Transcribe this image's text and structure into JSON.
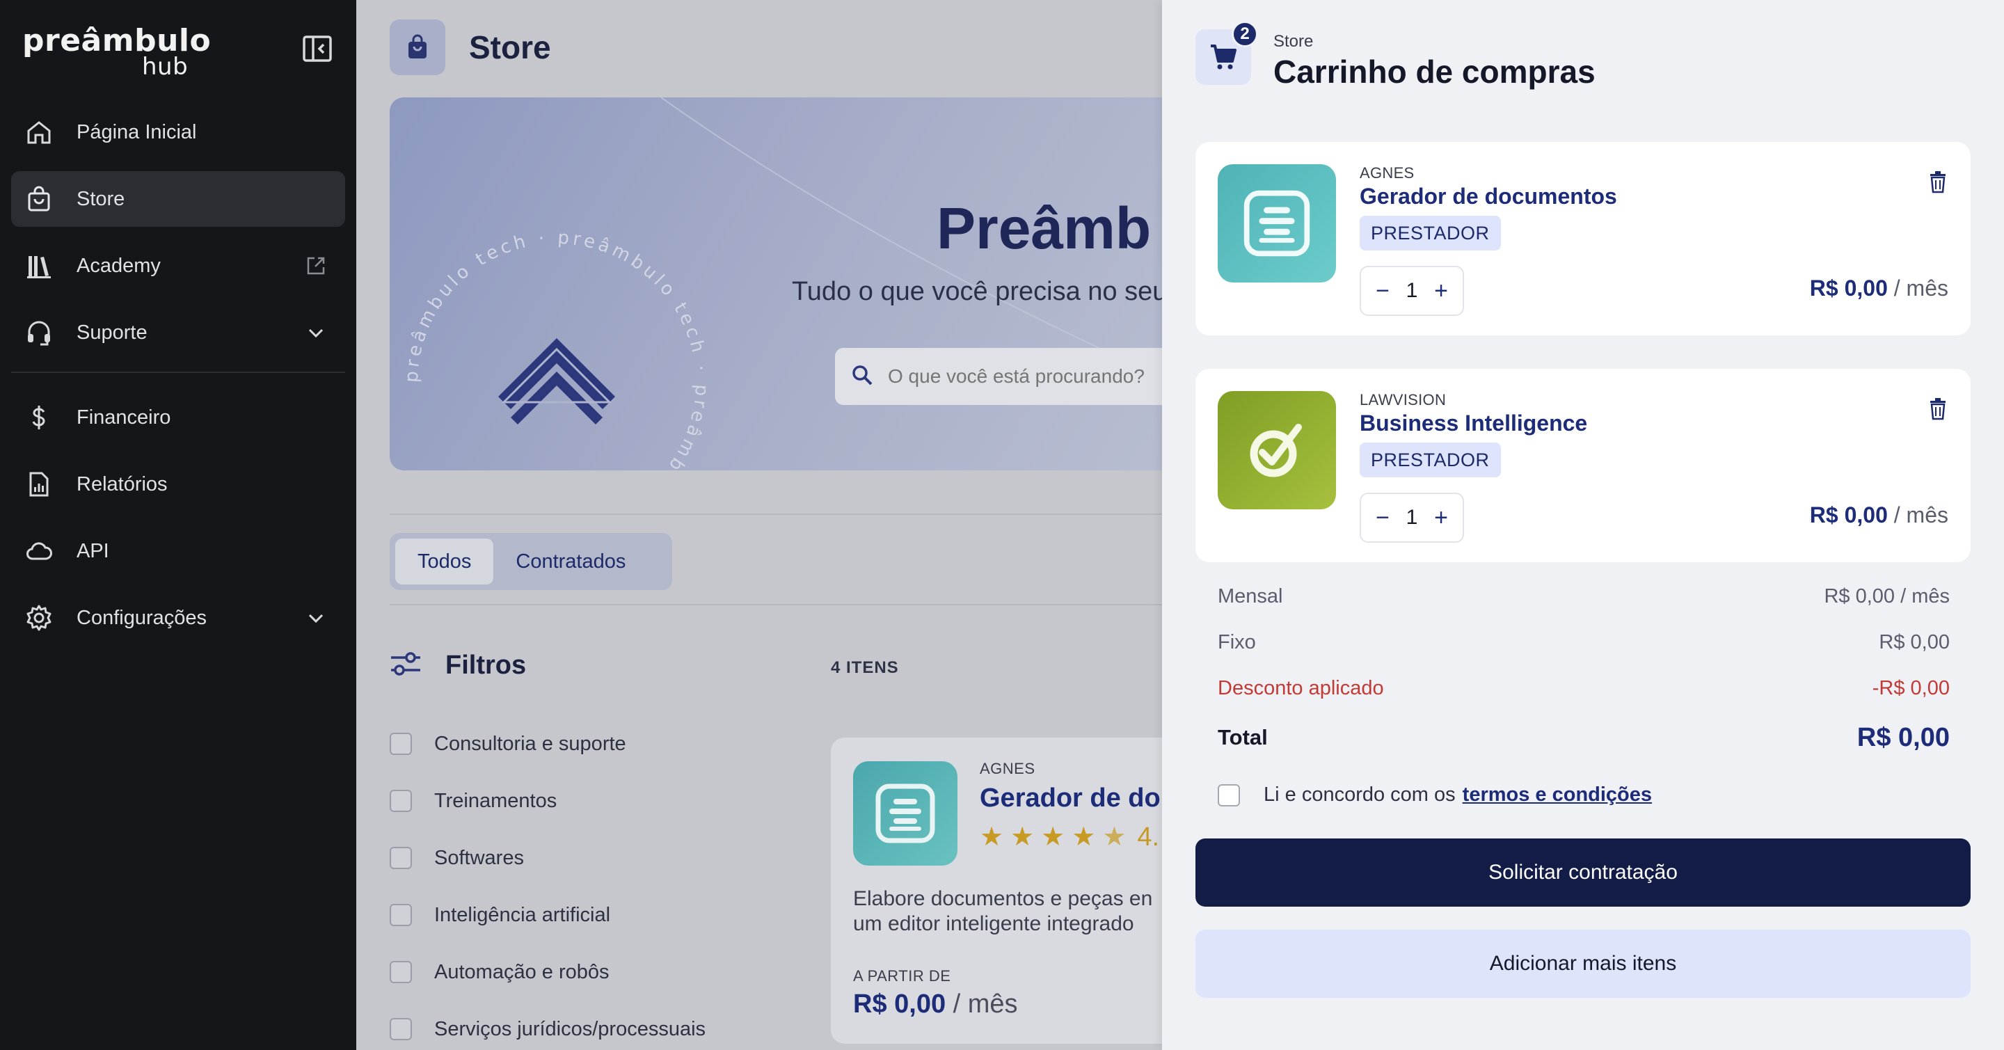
{
  "brand": {
    "line1": "preâmbulo",
    "line2": "hub"
  },
  "sidebar": {
    "items": [
      {
        "label": "Página Inicial",
        "icon": "home-icon"
      },
      {
        "label": "Store",
        "icon": "shopping-bag-icon"
      },
      {
        "label": "Academy",
        "icon": "books-icon"
      },
      {
        "label": "Suporte",
        "icon": "headset-icon"
      },
      {
        "label": "Financeiro",
        "icon": "dollar-icon"
      },
      {
        "label": "Relatórios",
        "icon": "report-icon"
      },
      {
        "label": "API",
        "icon": "cloud-icon"
      },
      {
        "label": "Configurações",
        "icon": "gear-icon"
      }
    ],
    "active": "Store"
  },
  "main": {
    "title": "Store",
    "hero": {
      "title": "Preâmb",
      "subtitle": "Tudo o que você precisa no seu e",
      "seal_text": "preâmbulo tech · preâmbulo tech · preâmbulo tech ·",
      "search_placeholder": "O que você está procurando?"
    },
    "tabs": [
      {
        "label": "Todos"
      },
      {
        "label": "Contratados"
      }
    ],
    "filters_title": "Filtros",
    "items_count": "4 ITENS",
    "filters": [
      "Consultoria e suporte",
      "Treinamentos",
      "Softwares",
      "Inteligência artificial",
      "Automação e robôs",
      "Serviços jurídicos/processuais"
    ],
    "product_card": {
      "vendor": "AGNES",
      "name": "Gerador de do",
      "rating": "4.",
      "desc_line1": "Elabore documentos e peças en",
      "desc_line2": "um editor inteligente integrado",
      "from_label": "A PARTIR DE",
      "price": "R$ 0,00",
      "period": "/ mês"
    }
  },
  "cart": {
    "breadcrumb": "Store",
    "title": "Carrinho de compras",
    "badge_count": "2",
    "items": [
      {
        "vendor": "AGNES",
        "name": "Gerador de documentos",
        "badge": "PRESTADOR",
        "qty": "1",
        "price": "R$ 0,00",
        "period": "/ mês",
        "color": "#5ac3c4"
      },
      {
        "vendor": "LAWVISION",
        "name": "Business Intelligence",
        "badge": "PRESTADOR",
        "qty": "1",
        "price": "R$ 0,00",
        "period": "/ mês",
        "color": "#8fae2c"
      }
    ],
    "summary": {
      "mensal_label": "Mensal",
      "mensal_value": "R$ 0,00 / mês",
      "fixo_label": "Fixo",
      "fixo_value": "R$ 0,00",
      "desconto_label": "Desconto aplicado",
      "desconto_value": "-R$ 0,00",
      "total_label": "Total",
      "total_value": "R$ 0,00"
    },
    "terms_text": "Li e concordo com os",
    "terms_link": "termos e condições",
    "primary_button": "Solicitar contratação",
    "secondary_button": "Adicionar mais itens"
  },
  "colors": {
    "accent": "#1d2c78",
    "primary_button": "#131c46",
    "discount": "#c23a36"
  }
}
